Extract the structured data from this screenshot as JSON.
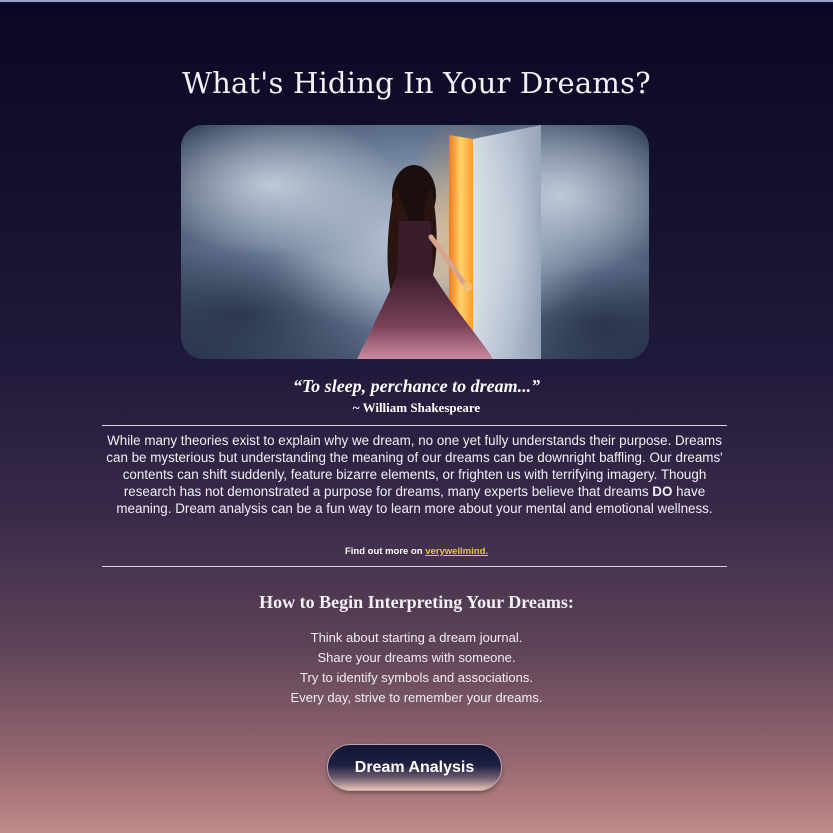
{
  "page": {
    "title": "What's Hiding In Your Dreams?"
  },
  "hero": {
    "icon": "woman-at-glowing-door-image"
  },
  "quote": {
    "text": "“To sleep, perchance to dream...”",
    "attribution": "~ William Shakespeare"
  },
  "intro": {
    "part1": "While many theories exist to explain why we dream, no one yet fully understands their purpose. Dreams can be mysterious but understanding the meaning of our dreams can be downright baffling. Our dreams' contents can shift suddenly, feature bizarre elements, or frighten us with terrifying imagery. Though research has not demonstrated a purpose for dreams, many experts believe that dreams ",
    "emphasis": "DO",
    "part2": " have meaning. Dream analysis can be a fun way to learn more about your mental and emotional wellness."
  },
  "source": {
    "prefix": "Find out more on ",
    "link_text": "verywellmind."
  },
  "tips": {
    "heading": "How to Begin Interpreting Your Dreams:",
    "items": [
      "Think about starting a dream journal.",
      "Share your dreams with someone.",
      "Try to identify symbols and associations.",
      "Every day, strive to remember your dreams."
    ]
  },
  "cta": {
    "label": "Dream Analysis"
  },
  "colors": {
    "link": "#e3c44e",
    "background_top": "#0a0826",
    "background_bottom": "#c08a88"
  }
}
